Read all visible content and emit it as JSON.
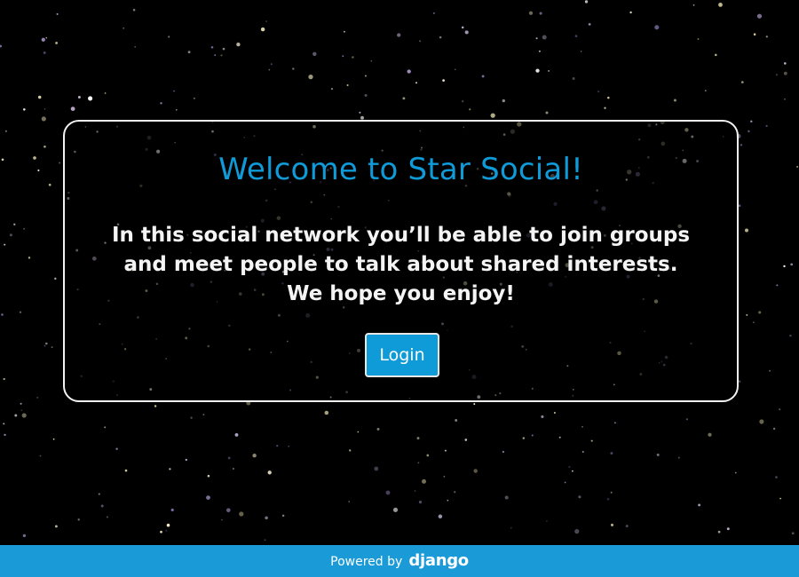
{
  "welcome": {
    "title": "Welcome to Star Social!",
    "message": "In this social network you’ll be able to join groups and meet people to talk about shared interests. We hope you enjoy!",
    "login_label": "Login"
  },
  "footer": {
    "powered_by": "Powered by",
    "brand": "django"
  },
  "colors": {
    "background": "#000000",
    "accent": "#0f9ad8",
    "footer": "#1a9ad6",
    "text": "#f4f4f4"
  }
}
